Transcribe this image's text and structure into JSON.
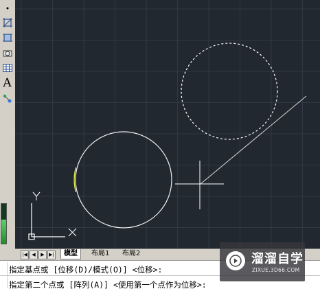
{
  "tabs": {
    "model": "模型",
    "layout1": "布局1",
    "layout2": "布局2"
  },
  "nav_buttons": [
    "|◀",
    "◀",
    "▶",
    "▶|"
  ],
  "ucs": {
    "y_label": "Y",
    "x_label": "X"
  },
  "toolbar": {
    "text_tool": "A"
  },
  "command": {
    "line1": "指定基点或 [位移(D)/模式(O)] <位移>:",
    "line2": "指定第二个点或 [阵列(A)] <使用第一个点作为位移>:"
  },
  "watermark": {
    "title": "溜溜自学",
    "subtitle": "ZIXUE.3D66.COM"
  },
  "colors": {
    "canvas_bg": "#212830",
    "grid": "#2f3843",
    "circle": "#ffffff",
    "selection_circle": "#ffffff",
    "crosshair": "#ffffff",
    "ucs": "#ffffff"
  },
  "icons": [
    "point-icon",
    "rectangle-icon",
    "region-icon",
    "block-icon",
    "table-icon",
    "text-icon",
    "multiline-text-icon"
  ],
  "level_meter": 0.6
}
